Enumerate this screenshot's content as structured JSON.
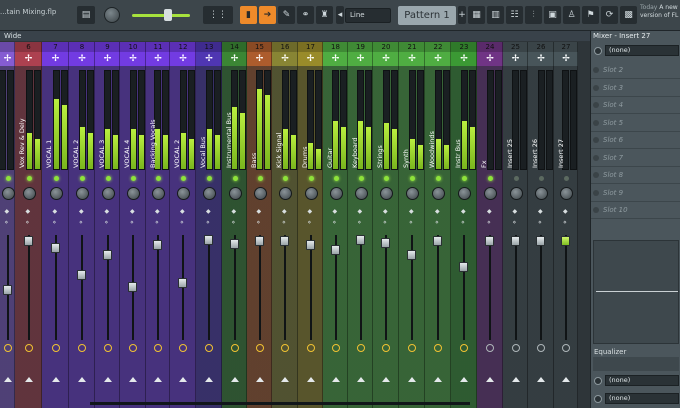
{
  "toolbar": {
    "title": "...tain Mixing.flp",
    "snap_label": "Line",
    "pattern_label": "Pattern 1",
    "news_today": "Today",
    "news_line1": "A new",
    "news_line2": "version of FL S"
  },
  "mixer_header": {
    "view_label": "Wide"
  },
  "channels": [
    {
      "num": "",
      "name": "",
      "color": "#6a4aa8"
    },
    {
      "num": "6",
      "name": "Vox Rev & Dely",
      "color": "#8a3440"
    },
    {
      "num": "7",
      "name": "VOCAL 1",
      "color": "#5b2fb5"
    },
    {
      "num": "8",
      "name": "VOCAL 2",
      "color": "#5b2fb5"
    },
    {
      "num": "9",
      "name": "VOCAL 3",
      "color": "#5b2fb5"
    },
    {
      "num": "10",
      "name": "VOCAL 4",
      "color": "#5b2fb5"
    },
    {
      "num": "11",
      "name": "Backing Vocals",
      "color": "#5b2fb5"
    },
    {
      "num": "12",
      "name": "VOCAL 2",
      "color": "#5b2fb5"
    },
    {
      "num": "13",
      "name": "Vocal Bus",
      "color": "#3f2b8e"
    },
    {
      "num": "14",
      "name": "Instrumental Bus",
      "color": "#2f6b2a"
    },
    {
      "num": "15",
      "name": "Bass",
      "color": "#8a4a24"
    },
    {
      "num": "16",
      "name": "Kick Signal",
      "color": "#6d6a2a"
    },
    {
      "num": "17",
      "name": "Drums",
      "color": "#7a6f22"
    },
    {
      "num": "18",
      "name": "Guitar",
      "color": "#3f8a35"
    },
    {
      "num": "19",
      "name": "Keyboard",
      "color": "#3f8a35"
    },
    {
      "num": "20",
      "name": "Strings",
      "color": "#3f8a35"
    },
    {
      "num": "21",
      "name": "Synth",
      "color": "#3f8a35"
    },
    {
      "num": "22",
      "name": "Woodwinds",
      "color": "#3f8a35"
    },
    {
      "num": "23",
      "name": "Instr Bus",
      "color": "#2f7a2a"
    },
    {
      "num": "24",
      "name": "Fx",
      "color": "#5a2a6a"
    },
    {
      "num": "25",
      "name": "Insert 25",
      "color": "#3a4448"
    },
    {
      "num": "26",
      "name": "Insert 26",
      "color": "#3a4448"
    },
    {
      "num": "27",
      "name": "Insert 27",
      "color": "#3a4448"
    }
  ],
  "panel": {
    "title": "Mixer - Insert 27",
    "input_label": "(none)",
    "slots": [
      "Slot 2",
      "Slot 3",
      "Slot 4",
      "Slot 5",
      "Slot 6",
      "Slot 7",
      "Slot 8",
      "Slot 9",
      "Slot 10"
    ],
    "eq_label": "Equalizer",
    "output1": "(none)",
    "output2": "(none)"
  },
  "colors": {
    "accent_green": "#a7e23d",
    "accent_orange": "#ee8a2a",
    "panel_bg": "#4b565c"
  }
}
